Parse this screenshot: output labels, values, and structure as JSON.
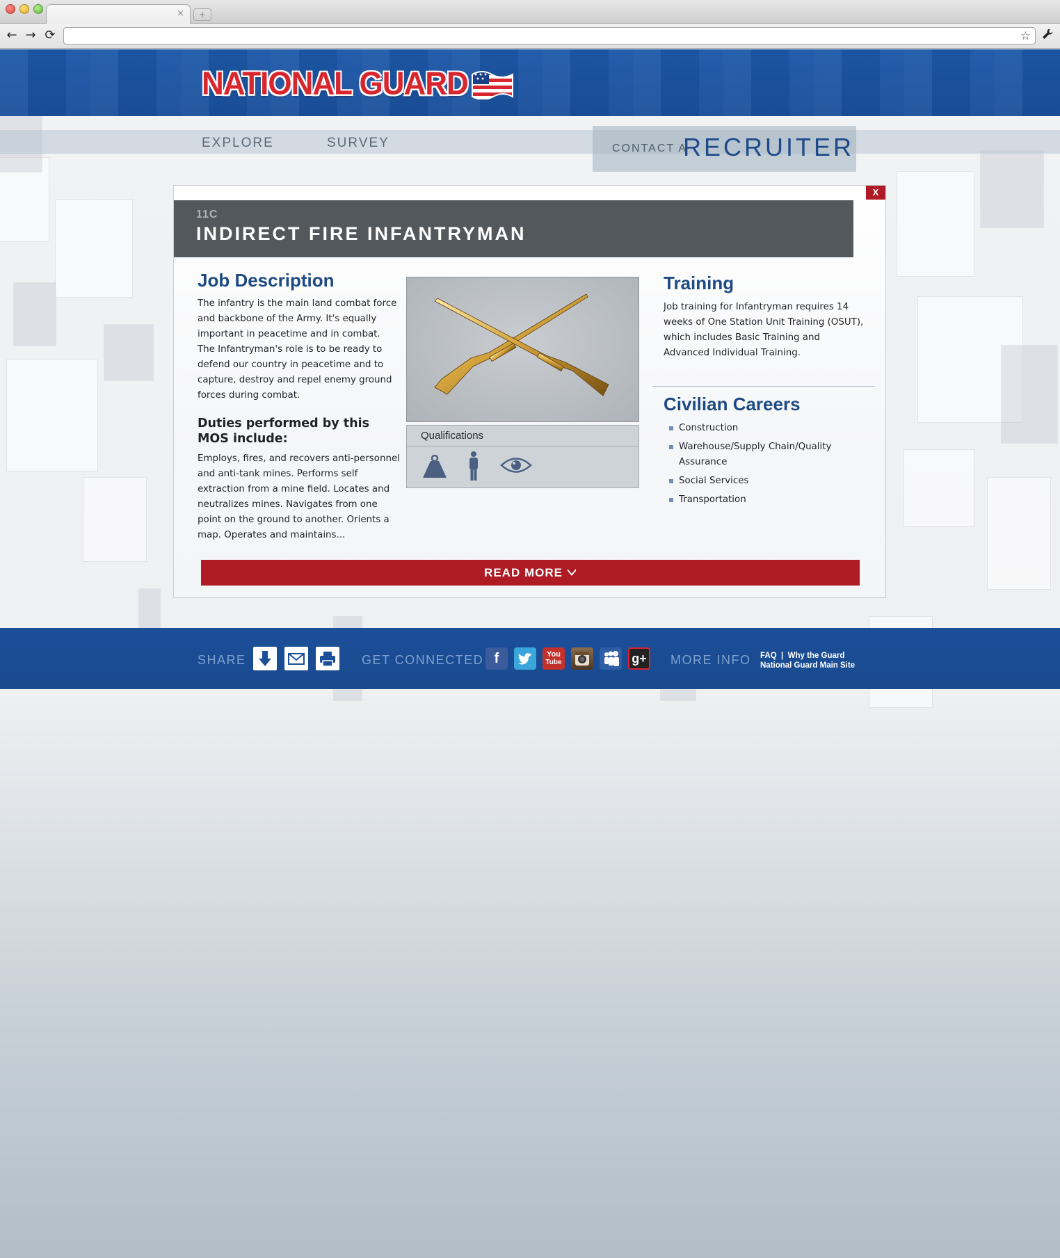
{
  "browser": {
    "tab_close": "×",
    "new_tab": "+",
    "back": "←",
    "forward": "→",
    "reload": "⟳",
    "url": "",
    "bookmark_icon": "star-icon",
    "settings_icon": "wrench-icon"
  },
  "header": {
    "logo_text": "NATIONAL GUARD",
    "brand_colors": {
      "blue": "#1d58a8",
      "red": "#d8262f"
    }
  },
  "nav": {
    "explore": "EXPLORE",
    "survey": "SURVEY",
    "contact_prefix": "CONTACT A",
    "recruiter": "RECRUITER"
  },
  "modal": {
    "close_label": "X",
    "code": "11C",
    "title": "INDIRECT FIRE INFANTRYMAN",
    "job_description": {
      "heading": "Job Description",
      "text": "The infantry is the main land combat force and backbone of the Army. It's equally important in peacetime and in combat. The Infantryman's role is to be ready to defend our country in peacetime and to capture, destroy and repel enemy ground forces during combat."
    },
    "duties": {
      "heading": "Duties performed by this MOS include:",
      "text": "Employs, fires, and recovers anti-personnel and anti-tank mines. Performs self extraction from a mine field. Locates and neutralizes mines. Navigates from one point on the ground to another. Orients a map. Operates and maintains..."
    },
    "image_icon": "crossed-rifles-insignia",
    "qualifications": {
      "heading": "Qualifications",
      "icons": [
        "weight-icon",
        "person-icon",
        "eye-icon"
      ]
    },
    "training": {
      "heading": "Training",
      "text": "Job training for Infantryman requires 14 weeks of One Station Unit Training (OSUT), which includes Basic Training and Advanced Individual Training."
    },
    "civilian_careers": {
      "heading": "Civilian Careers",
      "items": [
        "Construction",
        "Warehouse/Supply Chain/Quality Assurance",
        "Social Services",
        "Transportation"
      ]
    },
    "read_more": "READ MORE",
    "read_more_icon": "chevron-down-icon"
  },
  "footer": {
    "share": "SHARE",
    "share_icons": [
      "download-icon",
      "email-icon",
      "print-icon"
    ],
    "get_connected": "GET CONNECTED",
    "social_icons": [
      "facebook-icon",
      "twitter-icon",
      "youtube-icon",
      "instagram-icon",
      "myspace-icon",
      "google-plus-icon"
    ],
    "social_glyphs": {
      "facebook": "f",
      "youtube_top": "You",
      "youtube_bottom": "Tube",
      "googleplus": "g+"
    },
    "more_info": "MORE INFO",
    "links": {
      "faq": "FAQ",
      "separator": "|",
      "why": "Why the Guard",
      "main_site": "National Guard Main Site"
    }
  }
}
